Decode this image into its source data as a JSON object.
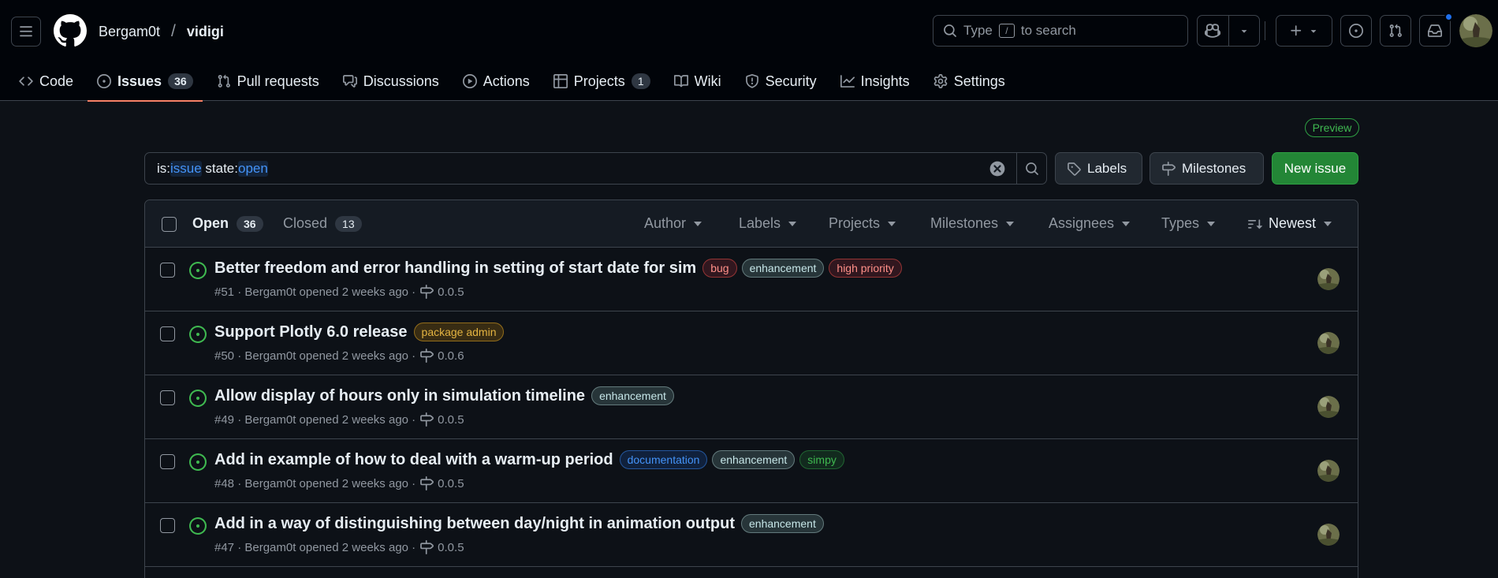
{
  "header": {
    "owner": "Bergam0t",
    "separator": "/",
    "repo": "vidigi",
    "search": {
      "prefix": "Type",
      "key": "/",
      "suffix": "to search"
    }
  },
  "tabs": [
    {
      "label": "Code",
      "icon": "code-icon"
    },
    {
      "label": "Issues",
      "icon": "issue-opened-icon",
      "count": "36",
      "active": true
    },
    {
      "label": "Pull requests",
      "icon": "git-pull-request-icon"
    },
    {
      "label": "Discussions",
      "icon": "comment-discussion-icon"
    },
    {
      "label": "Actions",
      "icon": "play-icon"
    },
    {
      "label": "Projects",
      "icon": "table-icon",
      "count": "1"
    },
    {
      "label": "Wiki",
      "icon": "book-icon"
    },
    {
      "label": "Security",
      "icon": "shield-icon"
    },
    {
      "label": "Insights",
      "icon": "graph-icon"
    },
    {
      "label": "Settings",
      "icon": "gear-icon"
    }
  ],
  "preview_badge": "Preview",
  "filter": {
    "t1": "is:",
    "t2": "issue",
    "t3": " state:",
    "t4": "open"
  },
  "buttons": {
    "labels": "Labels",
    "milestones": "Milestones",
    "new_issue": "New issue"
  },
  "list_header": {
    "open_label": "Open",
    "open_count": "36",
    "closed_label": "Closed",
    "closed_count": "13",
    "author": "Author",
    "labels": "Labels",
    "projects": "Projects",
    "milestones": "Milestones",
    "assignees": "Assignees",
    "types": "Types",
    "sort": "Newest"
  },
  "issues": [
    {
      "title": "Better freedom and error handling in setting of start date for sim",
      "labels": [
        {
          "name": "bug",
          "cls": "lbl-bug"
        },
        {
          "name": "enhancement",
          "cls": "lbl-enh"
        },
        {
          "name": "high priority",
          "cls": "lbl-high"
        }
      ],
      "meta": "#51 · Bergam0t opened 2 weeks ago ·",
      "milestone": "0.0.5"
    },
    {
      "title": "Support Plotly 6.0 release",
      "labels": [
        {
          "name": "package admin",
          "cls": "lbl-pkg"
        }
      ],
      "meta": "#50 · Bergam0t opened 2 weeks ago ·",
      "milestone": "0.0.6"
    },
    {
      "title": "Allow display of hours only in simulation timeline",
      "labels": [
        {
          "name": "enhancement",
          "cls": "lbl-enh"
        }
      ],
      "meta": "#49 · Bergam0t opened 2 weeks ago ·",
      "milestone": "0.0.5"
    },
    {
      "title": "Add in example of how to deal with a warm-up period",
      "labels": [
        {
          "name": "documentation",
          "cls": "lbl-doc"
        },
        {
          "name": "enhancement",
          "cls": "lbl-enh"
        },
        {
          "name": "simpy",
          "cls": "lbl-simpy"
        }
      ],
      "meta": "#48 · Bergam0t opened 2 weeks ago ·",
      "milestone": "0.0.5"
    },
    {
      "title": "Add in a way of distinguishing between day/night in animation output",
      "labels": [
        {
          "name": "enhancement",
          "cls": "lbl-enh"
        }
      ],
      "meta": "#47 · Bergam0t opened 2 weeks ago ·",
      "milestone": "0.0.5"
    }
  ]
}
